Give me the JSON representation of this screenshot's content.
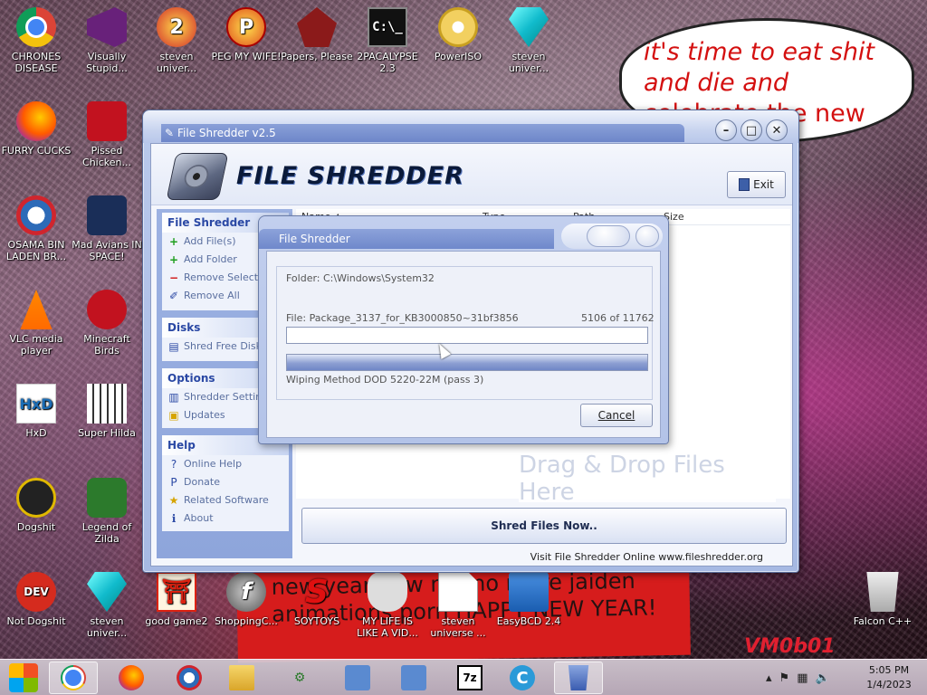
{
  "desktop": {
    "bubble_text": "it's time to eat shit and die and",
    "bubble_tail": "celebrate the new year",
    "banner_text": "new year new me no more jaiden animations porn HAPPY NEW YEAR!",
    "signature": "VM0b01",
    "icons": [
      {
        "label": "CHRONES DISEASE",
        "icon": "chrome-icon"
      },
      {
        "label": "Visually Stupid...",
        "icon": "visual-studio-icon"
      },
      {
        "label": "steven univer...",
        "icon": "steven-universe-icon"
      },
      {
        "label": "PEG MY WIFE!",
        "icon": "peggle-icon"
      },
      {
        "label": "Papers, Please",
        "icon": "papers-please-icon"
      },
      {
        "label": "2PACALYPSE 2.3",
        "icon": "cmd-icon"
      },
      {
        "label": "PowerISO",
        "icon": "poweriso-icon"
      },
      {
        "label": "steven univer...",
        "icon": "diamond-icon"
      },
      {
        "label": "FURRY CUCKS",
        "icon": "firefox-icon"
      },
      {
        "label": "Pissed Chicken...",
        "icon": "angry-birds-seasons-icon"
      },
      {
        "label": "OSAMA BIN LADEN BR...",
        "icon": "obama-logo-icon"
      },
      {
        "label": "Mad Avians IN SPACE!",
        "icon": "angry-birds-space-icon"
      },
      {
        "label": "VLC media player",
        "icon": "vlc-icon"
      },
      {
        "label": "Minecraft Birds",
        "icon": "angry-birds-icon"
      },
      {
        "label": "HxD",
        "icon": "hxd-icon"
      },
      {
        "label": "Super Hilda",
        "icon": "super-hilda-icon"
      },
      {
        "label": "Dogshit",
        "icon": "dogshit-icon"
      },
      {
        "label": "Legend of Zilda",
        "icon": "zelda-icon"
      },
      {
        "label": "Not Dogshit",
        "icon": "dev-cpp-icon"
      },
      {
        "label": "steven univer...",
        "icon": "diamond-icon"
      },
      {
        "label": "good game2",
        "icon": "torii-icon"
      },
      {
        "label": "ShoppingC...",
        "icon": "flash-icon"
      },
      {
        "label": "SOYTOYS",
        "icon": "soytoys-icon"
      },
      {
        "label": "MY LIFE IS LIKE A VID...",
        "icon": "gamepad-icon"
      },
      {
        "label": "steven universe ...",
        "icon": "document-icon"
      },
      {
        "label": "EasyBCD 2.4",
        "icon": "easybcd-icon"
      },
      {
        "label": "Falcon C++",
        "icon": "recycle-bin-icon"
      }
    ]
  },
  "window": {
    "title": "File Shredder v2.5",
    "app_title": "FILE SHREDDER",
    "exit_label": "Exit",
    "sidebar": {
      "groups": [
        {
          "title": "File Shredder",
          "items": [
            {
              "label": "Add File(s)",
              "icon": "add-icon"
            },
            {
              "label": "Add Folder",
              "icon": "add-icon"
            },
            {
              "label": "Remove Selected",
              "icon": "remove-icon"
            },
            {
              "label": "Remove All",
              "icon": "eraser-icon"
            }
          ]
        },
        {
          "title": "Disks",
          "items": [
            {
              "label": "Shred Free Disk Space",
              "icon": "disk-icon"
            }
          ]
        },
        {
          "title": "Options",
          "items": [
            {
              "label": "Shredder Settings",
              "icon": "settings-icon"
            },
            {
              "label": "Updates",
              "icon": "updates-icon"
            }
          ]
        },
        {
          "title": "Help",
          "items": [
            {
              "label": "Online Help",
              "icon": "help-icon"
            },
            {
              "label": "Donate",
              "icon": "paypal-icon"
            },
            {
              "label": "Related Software",
              "icon": "star-icon"
            },
            {
              "label": "About",
              "icon": "info-icon"
            }
          ]
        }
      ]
    },
    "columns": [
      "Name",
      "Type",
      "Path",
      "Size"
    ],
    "drop_hint": "Drag & Drop Files Here",
    "shred_button": "Shred Files Now..",
    "status_text": "Visit File Shredder Online  www.fileshredder.org"
  },
  "dialog": {
    "title": "File Shredder",
    "folder": "Folder: C:\\Windows\\System32",
    "file": "File: Package_3137_for_KB3000850~31bf3856",
    "count": "5106  of  11762",
    "file_progress": 0.0,
    "pass_progress": 1.0,
    "method": "Wiping Method DOD 5220-22M  (pass 3)",
    "cancel_label": "Cancel"
  },
  "taskbar": {
    "buttons": [
      "start",
      "chrome",
      "firefox",
      "obama",
      "explorer",
      "network",
      "remote",
      "remote2",
      "7zip",
      "ccleaner",
      "shredder"
    ],
    "time": "5:05 PM",
    "date": "1/4/2023"
  }
}
